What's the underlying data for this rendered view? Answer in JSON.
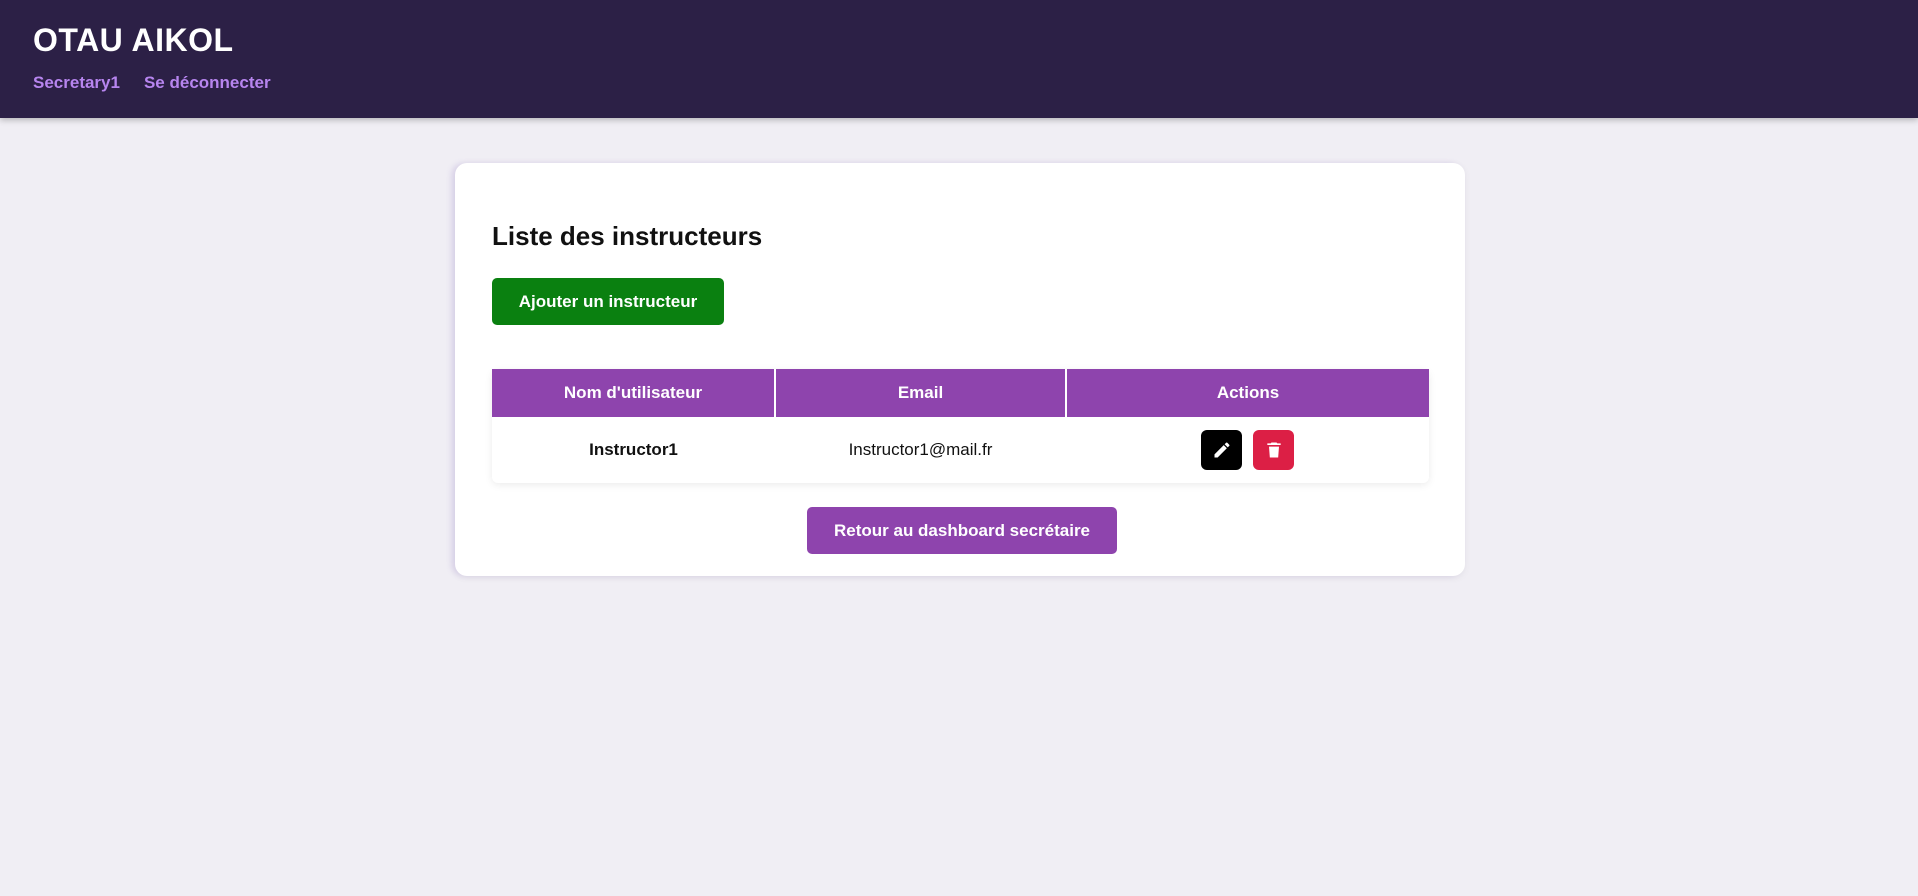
{
  "header": {
    "brand": "OTAU AIKOL",
    "nav": {
      "user": "Secretary1",
      "logout": "Se déconnecter"
    }
  },
  "main": {
    "title": "Liste des instructeurs",
    "add_button": "Ajouter un instructeur",
    "table": {
      "columns": [
        "Nom d'utilisateur",
        "Email",
        "Actions"
      ],
      "rows": [
        {
          "username": "Instructor1",
          "email": "Instructor1@mail.fr",
          "actions": [
            "pencil-icon",
            "trash-icon"
          ]
        }
      ]
    },
    "back_button": "Retour au dashboard secrétaire"
  },
  "colors": {
    "header_bg": "#2c2046",
    "nav_link": "#b785ef",
    "accent_purple": "#8e44ad",
    "add_green": "#0a8010",
    "delete_red": "#dc1f45",
    "page_bg": "#f0eef4"
  }
}
